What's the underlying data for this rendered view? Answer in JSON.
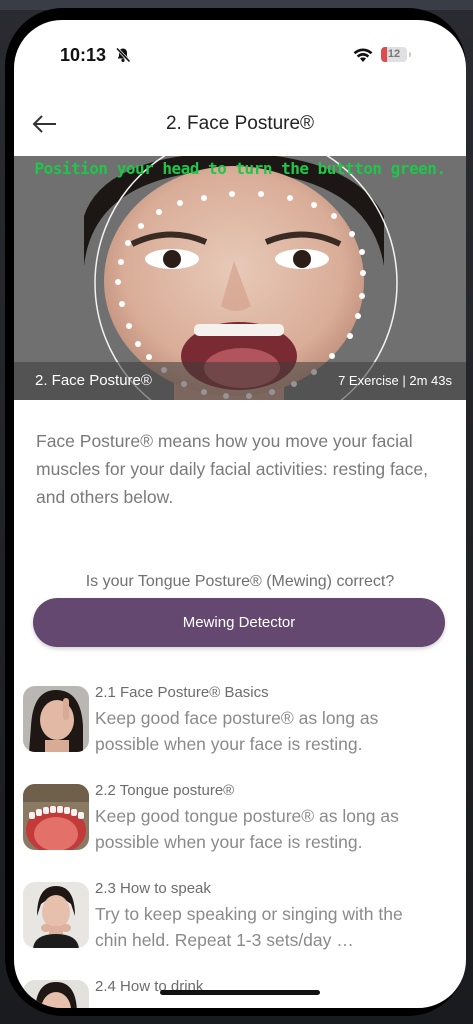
{
  "status_bar": {
    "time": "10:13",
    "battery": "12",
    "icons": [
      "bell-off-icon",
      "wifi-icon",
      "battery-icon"
    ]
  },
  "header": {
    "back_icon": "arrow-left-icon",
    "title": "2. Face Posture®"
  },
  "hero": {
    "instruction": "Position your head to turn the buttton green.",
    "footer_title": "2. Face Posture®",
    "footer_meta": "7 Exercise | 2m 43s",
    "instruction_color": "#1fc64a"
  },
  "description": "Face Posture® means how you move your facial muscles for your daily facial activities: resting face, and others below.",
  "mewing": {
    "question": "Is your Tongue Posture® (Mewing) correct?",
    "button_label": "Mewing Detector",
    "button_color": "#654870"
  },
  "exercises": [
    {
      "title": "2.1 Face Posture® Basics",
      "description": "Keep good face posture® as long as possible when your face is resting."
    },
    {
      "title": "2.2 Tongue posture®",
      "description": "Keep good tongue posture® as long as possible when your face is resting."
    },
    {
      "title": "2.3 How to speak",
      "description": "Try to keep speaking or singing with the chin held.  Repeat 1-3 sets/day …"
    },
    {
      "title": "2.4 How to drink",
      "description": ""
    }
  ]
}
